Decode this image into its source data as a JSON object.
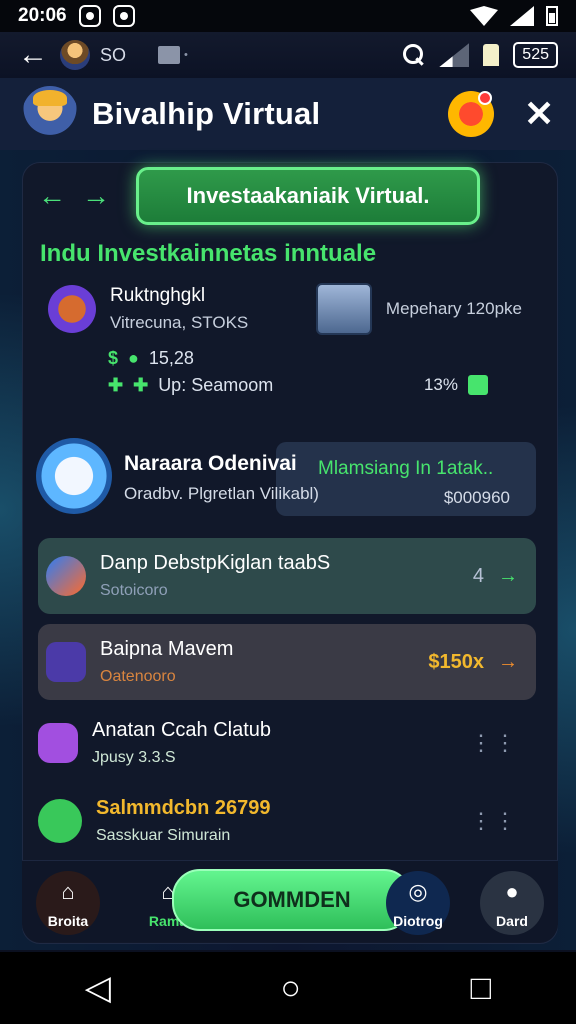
{
  "status": {
    "time": "20:06",
    "battery_num": "525"
  },
  "top_nav": {
    "count": "SO"
  },
  "header": {
    "title": "Bivalhip Virtual"
  },
  "panel": {
    "pill_label": "Investaakaniaik Virtual."
  },
  "section": {
    "title": "Indu Investkainnetas inntuale"
  },
  "row_a": {
    "title": "Ruktnghgkl",
    "sub": "Vitrecuna, STOKS",
    "right_label": "Mepehary 120pke"
  },
  "stats": {
    "line1_label": "15,28",
    "line2_label": "Up: Seamoom",
    "pct": "13%"
  },
  "invest": {
    "title": "Naraara Odenivai",
    "sub": "Oradbv. Plgretlan Vilikabl)",
    "highlight": "Mlamsiang In 1atak..",
    "amount": "$000960"
  },
  "list": [
    {
      "title": "Danp DebstpKiglan taabS",
      "sub": "Sotoicoro",
      "right": "4",
      "arrow": "→"
    },
    {
      "title": "Baipna Mavem",
      "sub": "Oatenooro",
      "right": "$150x",
      "arrow": "→"
    },
    {
      "title": "Anatan Ccah Clatub",
      "sub": "Jpusy 3.3.S"
    },
    {
      "title": "Salmmdcbn 26799",
      "sub": "Sasskuar Simurain"
    }
  ],
  "bottom": {
    "left": "Broita",
    "home2": "Rama",
    "cta": "GOMMDEN",
    "gift": "Diotrog",
    "profile": "Dard"
  },
  "colors": {
    "accent_green": "#47e46d",
    "gold": "#f2b82d"
  }
}
